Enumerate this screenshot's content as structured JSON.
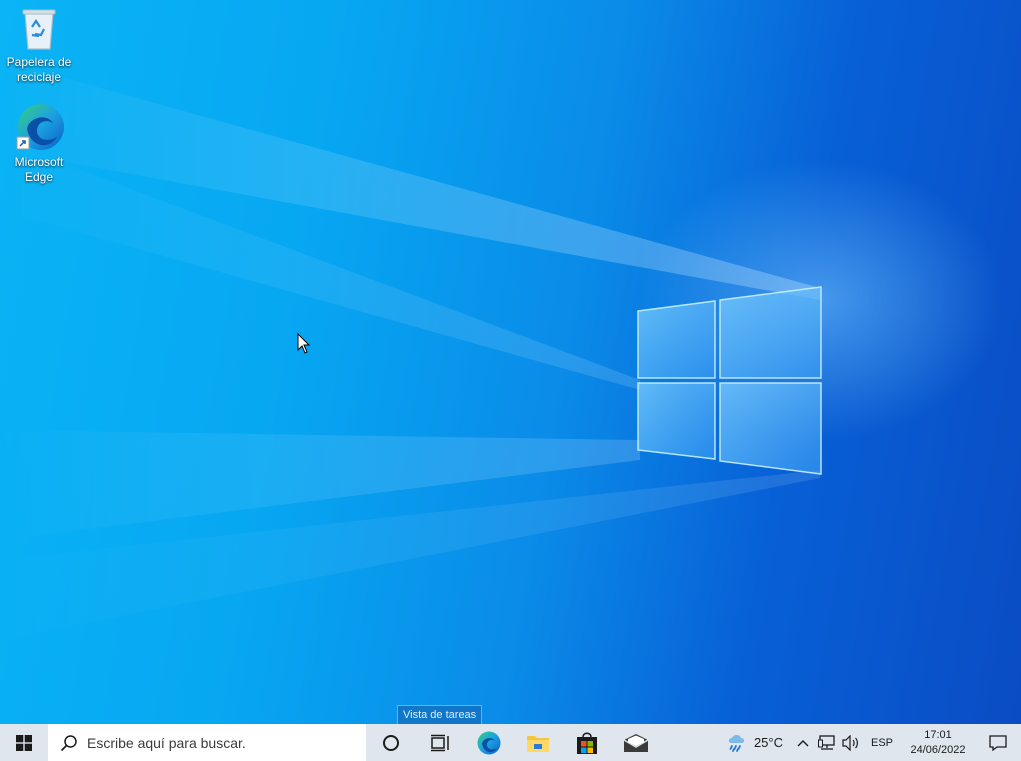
{
  "desktop": {
    "icons": [
      {
        "label_line1": "Papelera de",
        "label_line2": "reciclaje",
        "icon": "recycle-bin-icon"
      },
      {
        "label_line1": "Microsoft",
        "label_line2": "Edge",
        "icon": "edge-icon"
      }
    ],
    "accent_color": "#0a8be8"
  },
  "tooltip": {
    "text": "Vista de tareas"
  },
  "taskbar": {
    "start_icon": "windows-logo-icon",
    "search": {
      "placeholder": "Escribe aquí para buscar.",
      "icon": "search-icon"
    },
    "buttons": [
      {
        "name": "cortana-button",
        "icon": "circle-icon"
      },
      {
        "name": "task-view-button",
        "icon": "task-view-icon"
      },
      {
        "name": "edge-taskbar-button",
        "icon": "edge-icon"
      },
      {
        "name": "file-explorer-button",
        "icon": "folder-icon"
      },
      {
        "name": "store-button",
        "icon": "store-bag-icon"
      },
      {
        "name": "mail-button",
        "icon": "mail-icon"
      }
    ],
    "tray": {
      "weather": {
        "temp": "25°C",
        "icon": "rain-cloud-icon"
      },
      "language": "ESP",
      "clock": {
        "time": "17:01",
        "date": "24/06/2022"
      }
    },
    "background": "#dfe6ee"
  }
}
